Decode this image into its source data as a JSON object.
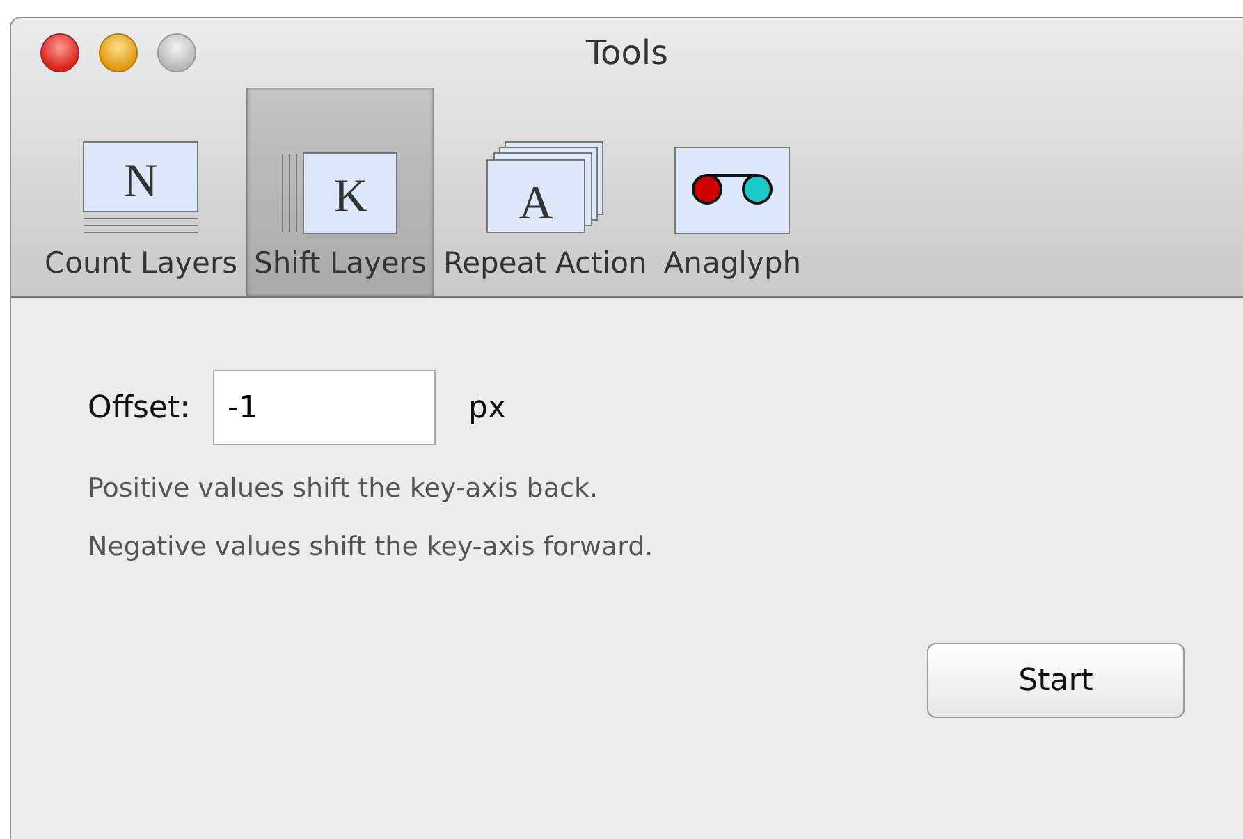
{
  "window": {
    "title": "Tools"
  },
  "toolbar": [
    {
      "label": "Count Layers",
      "kind": "layers-below",
      "glyph": "N",
      "selected": false
    },
    {
      "label": "Shift Layers",
      "kind": "layers-left",
      "glyph": "K",
      "selected": true
    },
    {
      "label": "Repeat Action",
      "kind": "layers-behind",
      "glyph": "A",
      "selected": false
    },
    {
      "label": "Anaglyph",
      "kind": "anaglyph",
      "selected": false
    }
  ],
  "offset": {
    "label": "Offset:",
    "value": "-1",
    "unit": "px"
  },
  "notes": [
    "Positive values shift the key-axis back.",
    "Negative values shift the key-axis forward."
  ],
  "buttons": [
    "Start"
  ]
}
